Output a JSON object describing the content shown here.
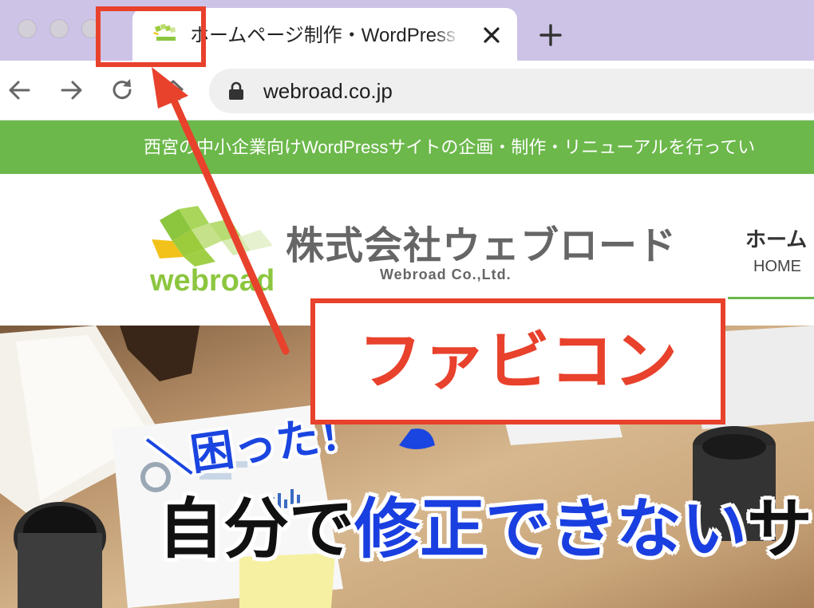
{
  "browser": {
    "tab": {
      "title": "ホームページ制作・WordPress｜西宮",
      "close_icon": "close-icon",
      "favicon_icon": "webroad-favicon-icon"
    },
    "new_tab_icon": "plus-icon",
    "nav_icons": [
      "back-arrow-icon",
      "forward-arrow-icon",
      "reload-icon",
      "home-icon"
    ],
    "address": {
      "url": "webroad.co.jp",
      "lock_icon": "lock-icon"
    }
  },
  "site": {
    "topbar_text": "西宮の中小企業向けWordPressサイトの企画・制作・リニューアルを行ってい",
    "topbar_color": "#6cb84b",
    "logo": {
      "wordmark": "webroad",
      "company_jp": "株式会社ウェブロード",
      "company_en": "Webroad Co.,Ltd."
    },
    "nav": {
      "item_jp": "ホーム",
      "item_en": "HOME"
    },
    "hero": {
      "line1": "＼困った！",
      "line2_black_1": "自分で",
      "line2_blue": "修正できない",
      "line2_black_2": "サ"
    }
  },
  "annotation": {
    "label": "ファビコン",
    "color": "#e8412c"
  }
}
